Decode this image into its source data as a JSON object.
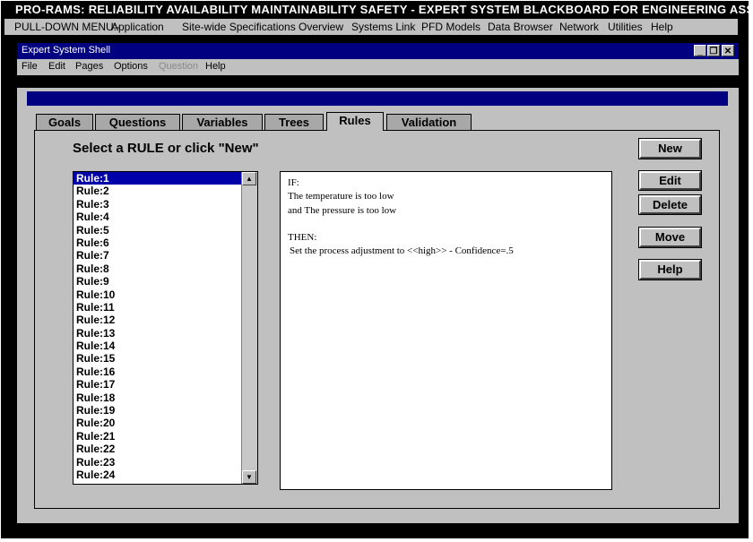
{
  "app": {
    "title": "PRO-RAMS: RELIABILITY AVAILABILITY MAINTAINABILITY SAFETY - EXPERT SYSTEM BLACKBOARD FOR ENGINEERING ASSETS",
    "menu_prefix": "PULL-DOWN MENU:-",
    "menu": [
      "Application",
      "Site-wide Specifications",
      "Overview",
      "Systems Link",
      "PFD Models",
      "Data Browser",
      "Network",
      "Utilities",
      "Help"
    ]
  },
  "shell": {
    "title": "Expert System Shell",
    "menu": [
      "File",
      "Edit",
      "Pages",
      "Options",
      "Question",
      "Help"
    ],
    "window_controls": {
      "minimize": "_",
      "restore": "❐",
      "close": "✕"
    }
  },
  "tabs": [
    "Goals",
    "Questions",
    "Variables",
    "Trees",
    "Rules",
    "Validation"
  ],
  "active_tab": "Rules",
  "heading": "Select a RULE or click \"New\"",
  "buttons": {
    "new": "New",
    "edit": "Edit",
    "delete": "Delete",
    "move": "Move",
    "help": "Help"
  },
  "rules_list": [
    "Rule:1",
    "Rule:2",
    "Rule:3",
    "Rule:4",
    "Rule:5",
    "Rule:6",
    "Rule:7",
    "Rule:8",
    "Rule:9",
    "Rule:10",
    "Rule:11",
    "Rule:12",
    "Rule:13",
    "Rule:14",
    "Rule:15",
    "Rule:16",
    "Rule:17",
    "Rule:18",
    "Rule:19",
    "Rule:20",
    "Rule:21",
    "Rule:22",
    "Rule:23",
    "Rule:24"
  ],
  "selected_rule": "Rule:1",
  "rule_detail": {
    "if_label": "IF:",
    "conditions": [
      "The temperature is too low",
      "and  The pressure is too low"
    ],
    "then_label": "THEN:",
    "action": "Set the process adjustment to <<high>> - Confidence=.5"
  },
  "colors": {
    "titlebar": "#000080",
    "selection": "#0000a8",
    "face": "#c0c0c0"
  }
}
